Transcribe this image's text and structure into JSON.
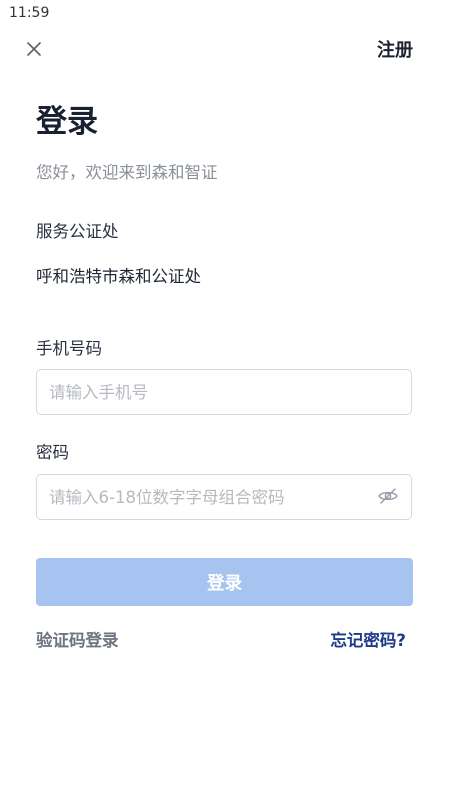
{
  "status_bar": {
    "time": "11:59"
  },
  "header": {
    "close_icon": "close-icon",
    "register_label": "注册"
  },
  "main": {
    "title": "登录",
    "welcome_text": "您好，欢迎来到森和智证",
    "service_label": "服务公证处",
    "service_value": "呼和浩特市森和公证处"
  },
  "form": {
    "phone": {
      "label": "手机号码",
      "placeholder": "请输入手机号",
      "value": ""
    },
    "password": {
      "label": "密码",
      "placeholder": "请输入6-18位数字字母组合密码",
      "value": "",
      "toggle_icon": "eye-off-icon"
    },
    "login_button_label": "登录"
  },
  "footer_links": {
    "sms_login": "验证码登录",
    "forgot_password": "忘记密码?"
  },
  "colors": {
    "primary_disabled": "#a7c4f0",
    "link_accent": "#1e3a8a",
    "muted_text": "#8a8f99"
  }
}
